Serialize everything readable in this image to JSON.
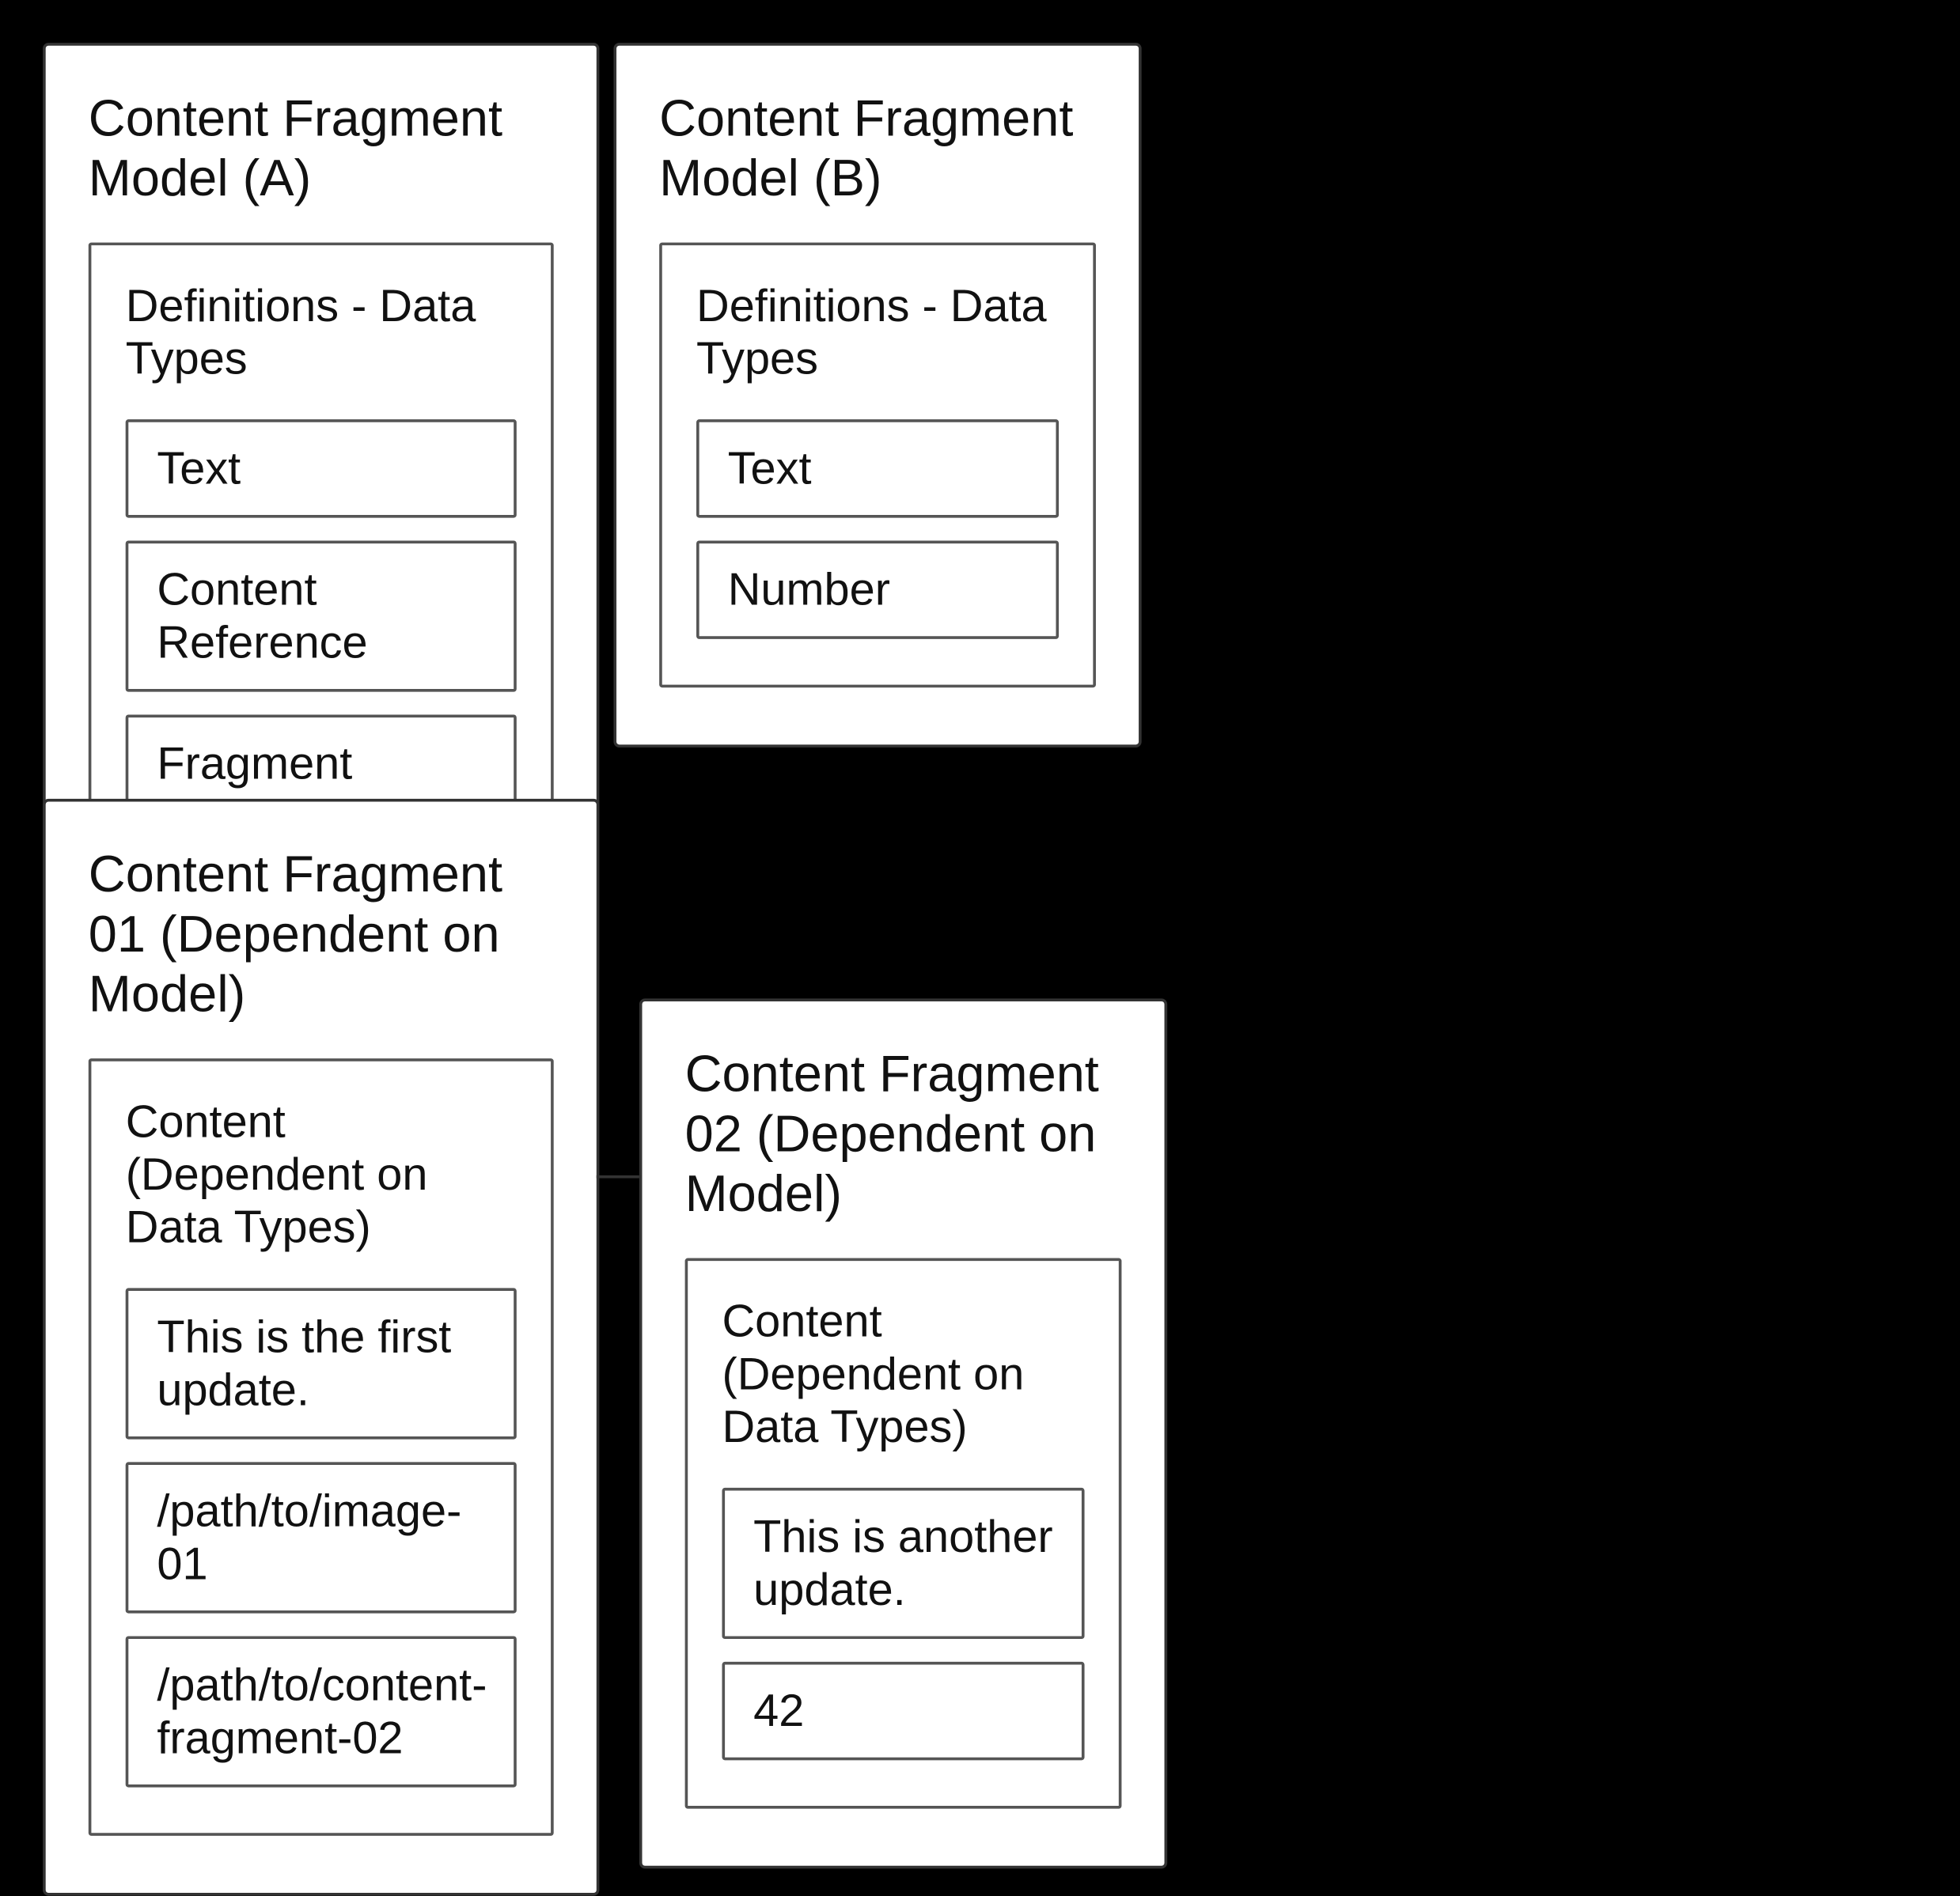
{
  "modelA": {
    "title": "Content Fragment Model (A)",
    "inner_title": "Definitions - Data Types",
    "items": [
      "Text",
      "Content Reference",
      "Fragment Reference"
    ]
  },
  "modelB": {
    "title": "Content Fragment Model (B)",
    "inner_title": "Definitions - Data Types",
    "items": [
      "Text",
      "Number"
    ]
  },
  "fragment01": {
    "title": "Content Fragment  01 (Dependent on Model)",
    "inner_title": "Content (Dependent on Data Types)",
    "items": [
      "This is the first update.",
      "/path/to/image-01",
      "/path/to/content-fragment-02"
    ]
  },
  "fragment02": {
    "title": "Content Fragment 02 (Dependent on Model)",
    "inner_title": "Content  (Dependent on Data Types)",
    "items": [
      "This is another update.",
      "42"
    ]
  }
}
